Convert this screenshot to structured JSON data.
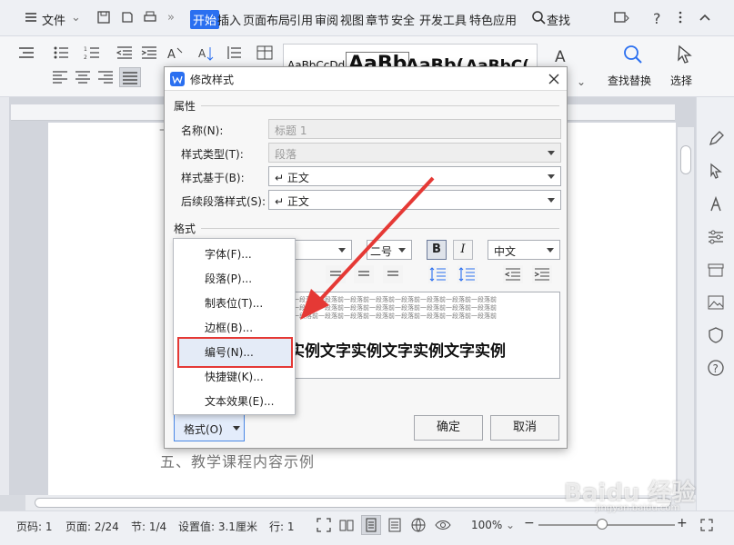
{
  "menubar": {
    "file_label": "文件",
    "tabs": [
      "开始",
      "插入",
      "页面布局",
      "引用",
      "审阅",
      "视图",
      "章节",
      "安全",
      "开发工具",
      "特色应用"
    ],
    "search_label": "查找"
  },
  "ribbon": {
    "styles": [
      "AaBbCcDd",
      "AaBb",
      "AaBb(",
      "AaBbC("
    ],
    "find_replace_label": "查找替换",
    "select_label": "选择"
  },
  "document": {
    "heading_five": "五、教学课程内容示例"
  },
  "dialog": {
    "title": "修改样式",
    "properties_label": "属性",
    "name_label": "名称(N):",
    "name_value": "标题 1",
    "style_type_label": "样式类型(T):",
    "style_type_value": "段落",
    "based_on_label": "样式基于(B):",
    "based_on_value": "↵ 正文",
    "next_style_label": "后续段落样式(S):",
    "next_style_value": "↵ 正文",
    "format_label": "格式",
    "font_size_value": "二号",
    "bold_label": "B",
    "italic_label": "I",
    "language_value": "中文",
    "preview_prev_text": "一段落前一段落前一段落前一段落前一段落前一段落前一段落前一段落前",
    "preview_sample_text": "实例文字实例文字实例文字实例",
    "format_button_label": "格式(O)",
    "ok_label": "确定",
    "cancel_label": "取消"
  },
  "popup_menu": {
    "items": [
      "字体(F)...",
      "段落(P)...",
      "制表位(T)...",
      "边框(B)...",
      "编号(N)...",
      "快捷键(K)...",
      "文本效果(E)..."
    ],
    "highlighted_index": 4
  },
  "statusbar": {
    "page_num": "页码: 1",
    "pages": "页面: 2/24",
    "section": "节: 1/4",
    "setting": "设置值: 3.1厘米",
    "row": "行: 1",
    "zoom": "100%"
  },
  "watermark": "Baidu 经验",
  "watermark_url": "jingyan.baidu.com",
  "colors": {
    "accent": "#2a6ff0",
    "highlight_box": "#e53935",
    "arrow": "#e53935"
  }
}
